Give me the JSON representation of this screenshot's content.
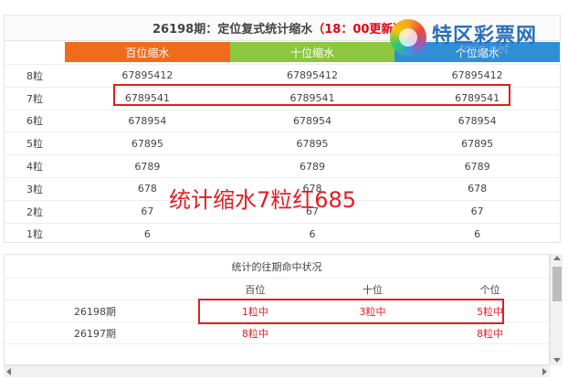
{
  "top": {
    "title_main": "26198期：定位复式统计缩水",
    "title_note": "（18：00更新）",
    "columns": [
      "百位缩水",
      "十位缩水",
      "个位缩水"
    ],
    "rows": [
      {
        "label": "8粒",
        "values": [
          "67895412",
          "67895412",
          "67895412"
        ]
      },
      {
        "label": "7粒",
        "values": [
          "6789541",
          "6789541",
          "6789541"
        ]
      },
      {
        "label": "6粒",
        "values": [
          "678954",
          "678954",
          "678954"
        ]
      },
      {
        "label": "5粒",
        "values": [
          "67895",
          "67895",
          "67895"
        ]
      },
      {
        "label": "4粒",
        "values": [
          "6789",
          "6789",
          "6789"
        ]
      },
      {
        "label": "3粒",
        "values": [
          "678",
          "678",
          "678"
        ]
      },
      {
        "label": "2粒",
        "values": [
          "67",
          "67",
          "67"
        ]
      },
      {
        "label": "1粒",
        "values": [
          "6",
          "6",
          "6"
        ]
      }
    ]
  },
  "logo": {
    "text": "特区彩票网",
    "url": "tqcp.net",
    "icon": "swirl-logo-icon"
  },
  "annotation": "统计缩水7粒红685",
  "bottom": {
    "title": "统计的往期命中状况",
    "headers": [
      "百位",
      "十位",
      "个位"
    ],
    "rows": [
      {
        "period": "26198期",
        "hits": [
          "1粒中",
          "3粒中",
          "5粒中"
        ]
      },
      {
        "period": "26197期",
        "hits": [
          "8粒中",
          "",
          "8粒中"
        ]
      }
    ]
  },
  "colors": {
    "hundreds": "#ef6c1c",
    "tens": "#8dc63f",
    "units": "#2f8fd6",
    "highlight": "#e31c23"
  }
}
